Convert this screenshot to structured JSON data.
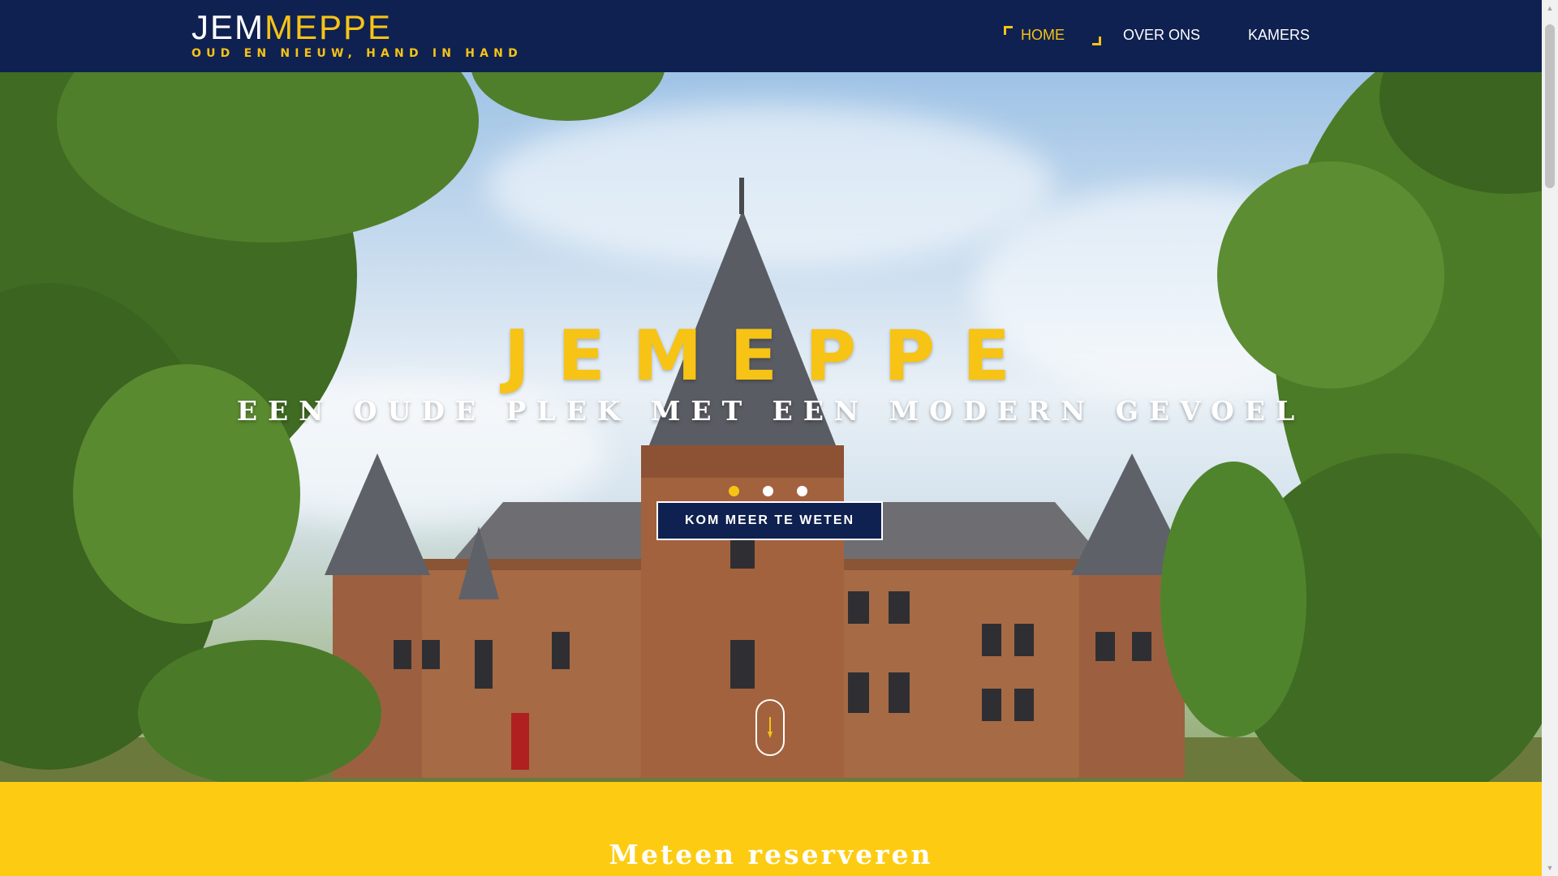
{
  "header": {
    "logo_part1": "JEM",
    "logo_part2": "MEPPE",
    "tagline": "OUD EN NIEUW, HAND IN HAND"
  },
  "nav": {
    "items": [
      {
        "label": "HOME",
        "active": true
      },
      {
        "label": "OVER ONS",
        "active": false
      },
      {
        "label": "KAMERS",
        "active": false
      }
    ]
  },
  "hero": {
    "title": "JEMEPPE",
    "subtitle": "EEN OUDE PLEK MET EEN MODERN GEVOEL",
    "slides_total": 3,
    "active_slide": 1,
    "cta_label": "KOM MEER TE WETEN",
    "scroll_icon": "arrow-down-icon",
    "background_image": "castle-photo"
  },
  "section": {
    "title": "Meteen reserveren"
  },
  "colors": {
    "navy": "#0f2150",
    "yellow": "#f7c315",
    "band_yellow": "#fdcc12",
    "white": "#ffffff"
  },
  "scrollbar": {
    "up_icon": "chevron-up-icon",
    "down_icon": "chevron-down-icon"
  }
}
